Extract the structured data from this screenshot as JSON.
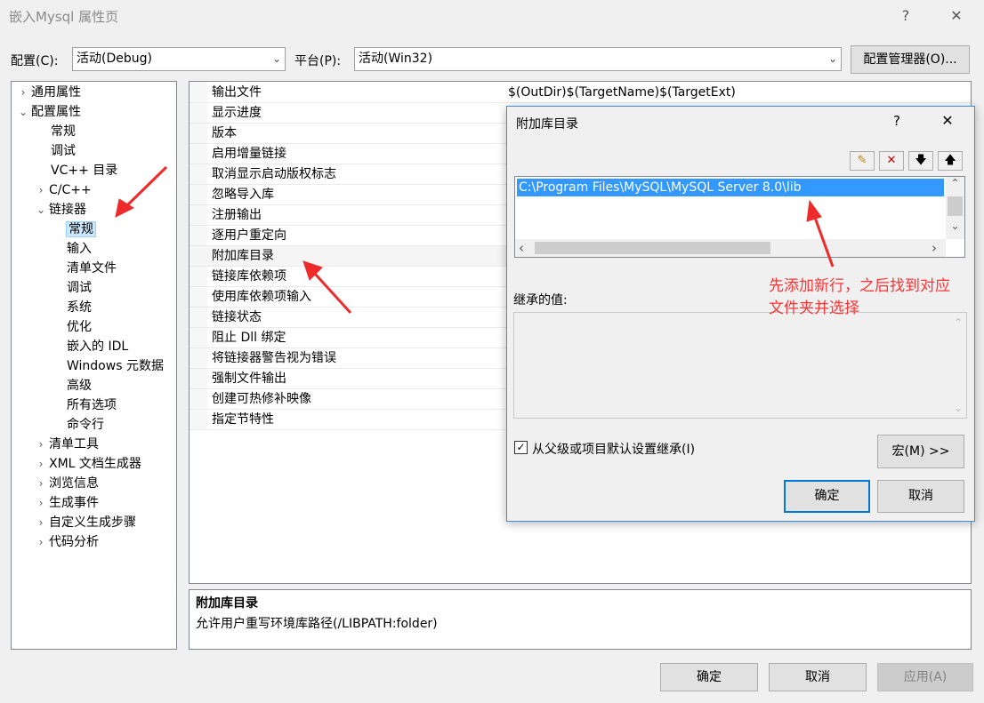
{
  "window": {
    "title": "嵌入Mysql 属性页",
    "help_glyph": "?",
    "close_glyph": "✕"
  },
  "config_bar": {
    "config_label": "配置(C):",
    "config_value": "活动(Debug)",
    "platform_label": "平台(P):",
    "platform_value": "活动(Win32)",
    "manager_button": "配置管理器(O)..."
  },
  "tree": {
    "items": [
      {
        "label": "通用属性",
        "chevron": "›"
      },
      {
        "label": "配置属性",
        "chevron": "⌄"
      },
      {
        "label": "常规",
        "chevron": ""
      },
      {
        "label": "调试",
        "chevron": ""
      },
      {
        "label": "VC++ 目录",
        "chevron": ""
      },
      {
        "label": "C/C++",
        "chevron": "›"
      },
      {
        "label": "链接器",
        "chevron": "⌄"
      },
      {
        "label": "常规",
        "chevron": ""
      },
      {
        "label": "输入",
        "chevron": ""
      },
      {
        "label": "清单文件",
        "chevron": ""
      },
      {
        "label": "调试",
        "chevron": ""
      },
      {
        "label": "系统",
        "chevron": ""
      },
      {
        "label": "优化",
        "chevron": ""
      },
      {
        "label": "嵌入的 IDL",
        "chevron": ""
      },
      {
        "label": "Windows 元数据",
        "chevron": ""
      },
      {
        "label": "高级",
        "chevron": ""
      },
      {
        "label": "所有选项",
        "chevron": ""
      },
      {
        "label": "命令行",
        "chevron": ""
      },
      {
        "label": "清单工具",
        "chevron": "›"
      },
      {
        "label": "XML 文档生成器",
        "chevron": "›"
      },
      {
        "label": "浏览信息",
        "chevron": "›"
      },
      {
        "label": "生成事件",
        "chevron": "›"
      },
      {
        "label": "自定义生成步骤",
        "chevron": "›"
      },
      {
        "label": "代码分析",
        "chevron": "›"
      }
    ]
  },
  "props": {
    "rows": [
      {
        "name": "输出文件",
        "value": "$(OutDir)$(TargetName)$(TargetExt)"
      },
      {
        "name": "显示进度",
        "value": ""
      },
      {
        "name": "版本",
        "value": ""
      },
      {
        "name": "启用增量链接",
        "value": ""
      },
      {
        "name": "取消显示启动版权标志",
        "value": ""
      },
      {
        "name": "忽略导入库",
        "value": ""
      },
      {
        "name": "注册输出",
        "value": ""
      },
      {
        "name": "逐用户重定向",
        "value": ""
      },
      {
        "name": "附加库目录",
        "value": ""
      },
      {
        "name": "链接库依赖项",
        "value": ""
      },
      {
        "name": "使用库依赖项输入",
        "value": ""
      },
      {
        "name": "链接状态",
        "value": ""
      },
      {
        "name": "阻止 Dll 绑定",
        "value": ""
      },
      {
        "name": "将链接器警告视为错误",
        "value": ""
      },
      {
        "name": "强制文件输出",
        "value": ""
      },
      {
        "name": "创建可热修补映像",
        "value": ""
      },
      {
        "name": "指定节特性",
        "value": ""
      }
    ]
  },
  "description": {
    "title": "附加库目录",
    "text": "允许用户重写环境库路径(/LIBPATH:folder)"
  },
  "footer": {
    "ok": "确定",
    "cancel": "取消",
    "apply": "应用(A)"
  },
  "dialog": {
    "title": "附加库目录",
    "help_glyph": "?",
    "close_glyph": "✕",
    "toolbar": {
      "new_line": "✎",
      "delete": "✕",
      "move_down": "🡇",
      "move_up": "🡅"
    },
    "entries": [
      "C:\\Program Files\\MySQL\\MySQL Server 8.0\\lib"
    ],
    "scroll_up": "⌃",
    "scroll_down": "⌄",
    "scroll_left": "‹",
    "scroll_right": "›",
    "inherited_label": "继承的值:",
    "inherit_checkbox_label": "从父级或项目默认设置继承(I)",
    "inherit_checked": true,
    "macros_button": "宏(M) >>",
    "ok": "确定",
    "cancel": "取消"
  },
  "annotation": {
    "line1": "先添加新行，之后找到对应",
    "line2": "文件夹并选择"
  }
}
